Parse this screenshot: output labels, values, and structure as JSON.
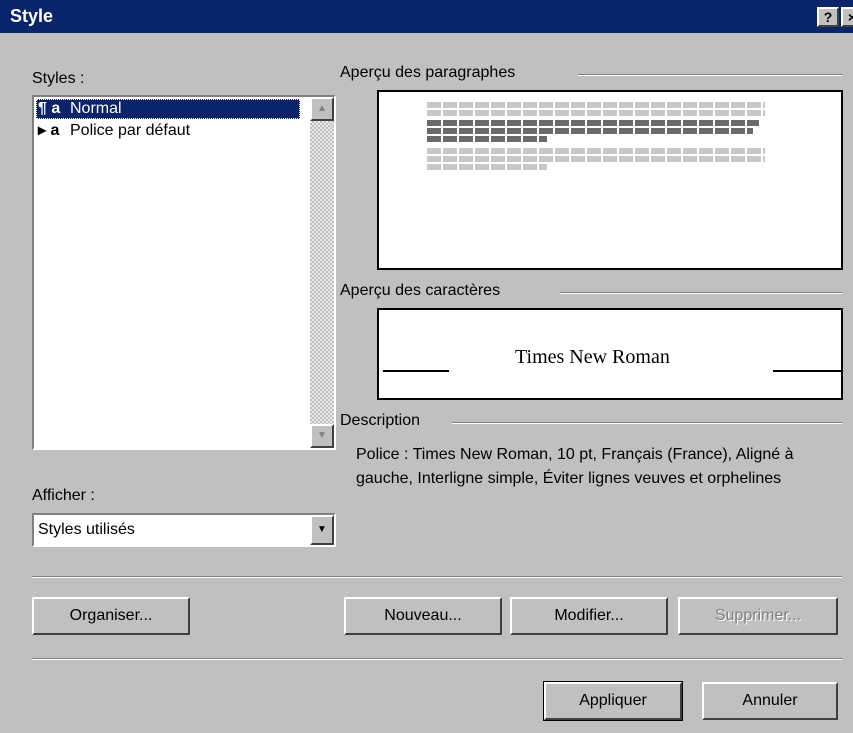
{
  "window": {
    "title": "Style",
    "help_label": "?",
    "close_label": "×"
  },
  "styles_label": "Styles :",
  "styles_list": [
    {
      "marker": "¶ a",
      "label": "Normal",
      "selected": true
    },
    {
      "marker": "▸ a",
      "label": "Police par défaut",
      "selected": false
    }
  ],
  "show_label": "Afficher :",
  "show_value": "Styles utilisés",
  "para_preview_label": "Aperçu des paragraphes",
  "char_preview_label": "Aperçu des caractères",
  "char_preview_sample": "Times New Roman",
  "description_label": "Description",
  "description_text": "Police : Times New Roman, 10 pt, Français (France), Aligné à gauche, Interligne simple, Éviter lignes veuves et orphelines",
  "buttons": {
    "organize": "Organiser...",
    "new": "Nouveau...",
    "modify": "Modifier...",
    "delete": "Supprimer...",
    "apply": "Appliquer",
    "cancel": "Annuler"
  },
  "colors": {
    "titlebar": "#0a246a",
    "face": "#c0c0c0",
    "selection": "#0a246a"
  }
}
